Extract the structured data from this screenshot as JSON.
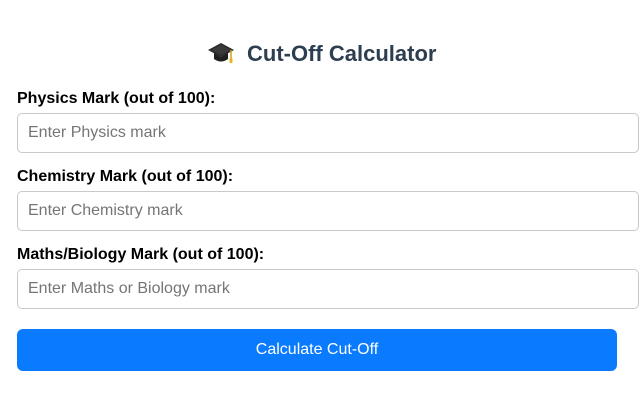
{
  "header": {
    "icon": "graduation-cap-icon",
    "title": "Cut-Off Calculator"
  },
  "form": {
    "physics": {
      "label": "Physics Mark (out of 100):",
      "placeholder": "Enter Physics mark",
      "value": ""
    },
    "chemistry": {
      "label": "Chemistry Mark (out of 100):",
      "placeholder": "Enter Chemistry mark",
      "value": ""
    },
    "maths": {
      "label": "Maths/Biology Mark (out of 100):",
      "placeholder": "Enter Maths or Biology mark",
      "value": ""
    },
    "submit_label": "Calculate Cut-Off"
  },
  "colors": {
    "accent": "#0a7bff",
    "title": "#2c3e50",
    "input_border": "#c9c9c9"
  }
}
